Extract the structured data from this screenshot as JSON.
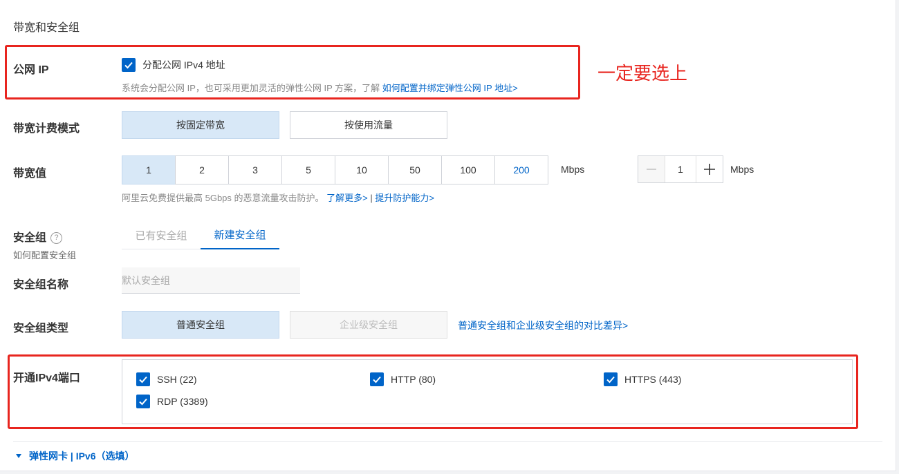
{
  "section": {
    "title": "带宽和安全组"
  },
  "public_ip": {
    "label": "公网 IP",
    "checkbox_label": "分配公网 IPv4 地址",
    "hint": "系统会分配公网 IP，也可采用更加灵活的弹性公网 IP 方案，了解",
    "hint_link": "如何配置并绑定弹性公网 IP 地址>",
    "checked": true
  },
  "annotation": {
    "text": "一定要选上",
    "color": "#e8251f"
  },
  "billing": {
    "label": "带宽计费模式",
    "options": [
      "按固定带宽",
      "按使用流量"
    ],
    "selected": 0
  },
  "bandwidth": {
    "label": "带宽值",
    "options": [
      "1",
      "2",
      "3",
      "5",
      "10",
      "50",
      "100",
      "200"
    ],
    "selected": "1",
    "unit": "Mbps",
    "stepper_value": "1",
    "stepper_unit": "Mbps",
    "hint": "阿里云免费提供最高 5Gbps 的恶意流量攻击防护。",
    "link_more": "了解更多>",
    "separator": "|",
    "link_upgrade": "提升防护能力>"
  },
  "security_group": {
    "label": "安全组",
    "help_icon": "?",
    "sub_label": "如何配置安全组",
    "tabs": [
      "已有安全组",
      "新建安全组"
    ],
    "active_tab": 1,
    "name_label": "安全组名称",
    "name_placeholder": "默认安全组",
    "type_label": "安全组类型",
    "types": [
      "普通安全组",
      "企业级安全组"
    ],
    "selected_type": 0,
    "compare_link": "普通安全组和企业级安全组的对比差异>"
  },
  "ports": {
    "label": "开通IPv4端口",
    "items": [
      {
        "label": "SSH (22)",
        "checked": true
      },
      {
        "label": "HTTP (80)",
        "checked": true
      },
      {
        "label": "HTTPS (443)",
        "checked": true
      },
      {
        "label": "RDP (3389)",
        "checked": true
      }
    ]
  },
  "footer": {
    "label": "弹性网卡 | IPv6（选填）",
    "icon": "caret-down-icon"
  },
  "colors": {
    "primary": "#0064c8",
    "selected_bg": "#d8e8f7",
    "highlight": "#e8251f"
  }
}
